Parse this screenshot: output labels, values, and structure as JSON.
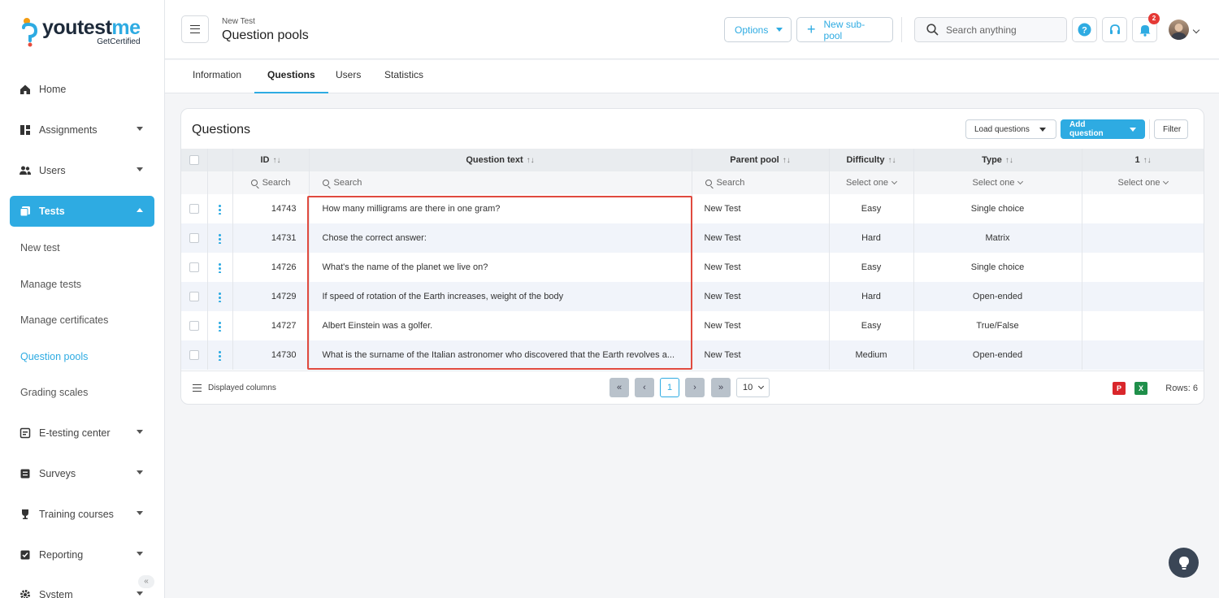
{
  "brand": {
    "name_part1": "youtest",
    "name_part2": "me",
    "tagline": "GetCertified"
  },
  "sidebar": {
    "items": [
      {
        "label": "Home"
      },
      {
        "label": "Assignments"
      },
      {
        "label": "Users"
      },
      {
        "label": "Tests"
      },
      {
        "label": "E-testing center"
      },
      {
        "label": "Surveys"
      },
      {
        "label": "Training courses"
      },
      {
        "label": "Reporting"
      },
      {
        "label": "System"
      }
    ],
    "tests_subitems": [
      {
        "label": "New test"
      },
      {
        "label": "Manage tests"
      },
      {
        "label": "Manage certificates"
      },
      {
        "label": "Question pools"
      },
      {
        "label": "Grading scales"
      }
    ],
    "collapse_glyph": "«"
  },
  "header": {
    "breadcrumb": "New Test",
    "title": "Question pools",
    "options_label": "Options",
    "new_subpool_label": "New sub-pool",
    "search_placeholder": "Search anything",
    "notification_count": "2"
  },
  "tabs": [
    {
      "label": "Information"
    },
    {
      "label": "Questions"
    },
    {
      "label": "Users"
    },
    {
      "label": "Statistics"
    }
  ],
  "questions": {
    "title": "Questions",
    "load_label": "Load questions",
    "add_label": "Add question",
    "filter_label": "Filter",
    "columns": {
      "id": "ID",
      "text": "Question text",
      "pool": "Parent pool",
      "difficulty": "Difficulty",
      "type": "Type",
      "extra": "1"
    },
    "sort_glyph": "↑↓",
    "search_label": "Search",
    "select_label": "Select one",
    "rows": [
      {
        "id": "14743",
        "text": "How many milligrams are there in one gram?",
        "pool": "New Test",
        "difficulty": "Easy",
        "type": "Single choice"
      },
      {
        "id": "14731",
        "text": "Chose the correct answer:",
        "pool": "New Test",
        "difficulty": "Hard",
        "type": "Matrix"
      },
      {
        "id": "14726",
        "text": "What's the name of the planet we live on?",
        "pool": "New Test",
        "difficulty": "Easy",
        "type": "Single choice"
      },
      {
        "id": "14729",
        "text": "If speed of rotation of the Earth increases, weight of the body",
        "pool": "New Test",
        "difficulty": "Hard",
        "type": "Open-ended"
      },
      {
        "id": "14727",
        "text": "Albert Einstein was a golfer.",
        "pool": "New Test",
        "difficulty": "Easy",
        "type": "True/False"
      },
      {
        "id": "14730",
        "text": "What is the surname of the Italian astronomer who discovered that the Earth revolves a...",
        "pool": "New Test",
        "difficulty": "Medium",
        "type": "Open-ended"
      }
    ],
    "footer": {
      "displayed_columns": "Displayed columns",
      "page_first": "«",
      "page_prev": "‹",
      "page_current": "1",
      "page_next": "›",
      "page_last": "»",
      "page_size": "10",
      "rows_label": "Rows: 6"
    }
  },
  "colors": {
    "accent": "#2eabe2",
    "highlight": "#e04a3f",
    "sidebar_active": "#2eabe2"
  }
}
